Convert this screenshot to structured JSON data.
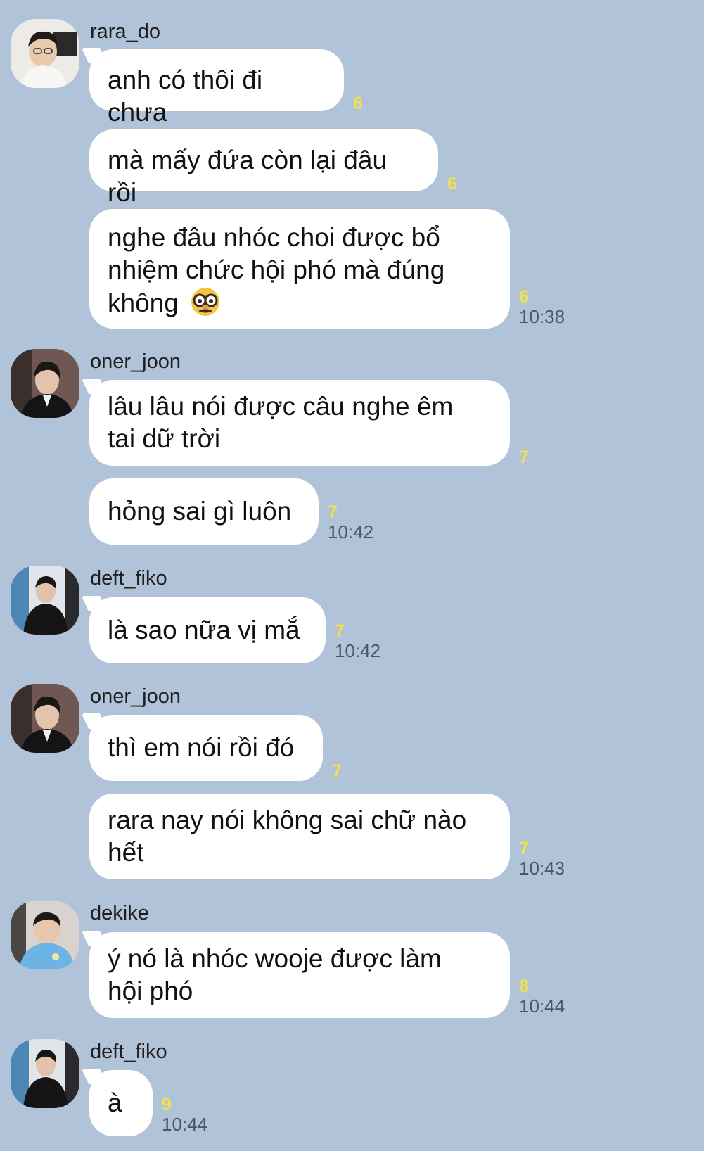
{
  "chat": {
    "groups": [
      {
        "sender": "rara_do",
        "avatar": "rara-do-avatar",
        "messages": [
          {
            "text": "anh có thôi đi chưa",
            "unread": "6",
            "time": ""
          },
          {
            "text": "mà mấy đứa còn lại đâu rồi",
            "unread": "6",
            "time": ""
          },
          {
            "text": "nghe đâu nhóc choi được bổ nhiệm chức hội phó mà đúng không 🥸",
            "lines": [
              "nghe đâu nhóc choi được bổ",
              "nhiệm chức hội phó mà đúng",
              "không"
            ],
            "emoji": "disguised-face-emoji",
            "unread": "6",
            "time": "10:38"
          }
        ]
      },
      {
        "sender": "oner_joon",
        "avatar": "oner-joon-avatar",
        "messages": [
          {
            "text": "lâu lâu nói được câu nghe êm tai dữ trời",
            "lines": [
              "lâu lâu nói được câu nghe êm",
              "tai dữ trời"
            ],
            "unread": "7",
            "time": ""
          },
          {
            "text": "hỏng sai gì luôn",
            "unread": "7",
            "time": "10:42"
          }
        ]
      },
      {
        "sender": "deft_fiko",
        "avatar": "deft-fiko-avatar",
        "messages": [
          {
            "text": "là sao nữa vị mắ",
            "unread": "7",
            "time": "10:42"
          }
        ]
      },
      {
        "sender": "oner_joon",
        "avatar": "oner-joon-avatar",
        "messages": [
          {
            "text": "thì em nói rồi đó",
            "unread": "7",
            "time": ""
          },
          {
            "text": "rara nay nói không sai chữ nào hết",
            "lines": [
              "rara nay nói không sai chữ nào",
              "hết"
            ],
            "unread": "7",
            "time": "10:43"
          }
        ]
      },
      {
        "sender": "dekike",
        "avatar": "dekike-avatar",
        "messages": [
          {
            "text": "ý nó là nhóc wooje được làm hội phó",
            "lines": [
              "ý nó là nhóc wooje được làm",
              "hội phó"
            ],
            "unread": "8",
            "time": "10:44"
          }
        ]
      },
      {
        "sender": "deft_fiko",
        "avatar": "deft-fiko-avatar",
        "messages": [
          {
            "text": "à",
            "unread": "9",
            "time": "10:44"
          }
        ]
      }
    ]
  }
}
